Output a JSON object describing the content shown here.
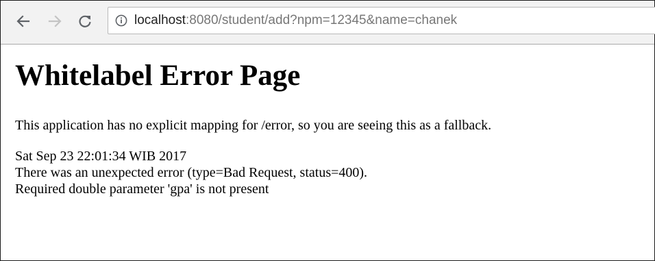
{
  "browser": {
    "url_host": "localhost",
    "url_rest": ":8080/student/add?npm=12345&name=chanek"
  },
  "page": {
    "title": "Whitelabel Error Page",
    "message": "This application has no explicit mapping for /error, so you are seeing this as a fallback.",
    "timestamp": "Sat Sep 23 22:01:34 WIB 2017",
    "error_line": "There was an unexpected error (type=Bad Request, status=400).",
    "detail_line": "Required double parameter 'gpa' is not present"
  },
  "colors": {
    "toolbar_bg": "#f2f2f2",
    "url_host": "#222222",
    "url_rest": "#777777",
    "icon_active": "#5f6368",
    "icon_disabled": "#c4c4c4"
  },
  "icons": {
    "back": "arrow-left-icon",
    "forward": "arrow-right-icon",
    "reload": "reload-icon",
    "info": "info-icon"
  }
}
